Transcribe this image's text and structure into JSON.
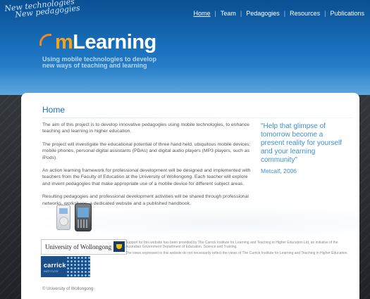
{
  "header": {
    "tagline": [
      "New technologies",
      "New pedagogies"
    ],
    "logo": {
      "prefix": "m",
      "text": "Learning"
    },
    "logo_subtitle": [
      "Using mobile technologies to develop",
      "new ways of teaching and learning"
    ],
    "nav": [
      {
        "label": "Home",
        "active": true
      },
      {
        "label": "Team",
        "active": false
      },
      {
        "label": "Pedagogies",
        "active": false
      },
      {
        "label": "Resources",
        "active": false
      },
      {
        "label": "Publications",
        "active": false
      }
    ]
  },
  "main": {
    "title": "Home",
    "paragraphs": [
      "The aim of this project is to develop innovative pedagogies using mobile technologies, to enhance teaching and learning in higher education.",
      "The project will investigate the educational potential of three hand held, ubiquitous mobile devices: mobile phones, personal digital assistants (PDAs) and digital audio players (MP3 players, such as iPods).",
      "An action learning framework for professional development will be designed and implemented with teachers from the Faculty of Education at the University of Wollongong. Each teacher will explore and invent pedagogies that make appropriate use of a mobile device for different subject areas.",
      "Resulting pedagogies and professional development activities will be shared through professional networks, workshops, a dedicated website and a published handbook."
    ],
    "quote": "\"Help that glimpse of tomorrow become a present reality for yourself and your learning community\"",
    "quote_author": "Metcalf, 2006"
  },
  "footer": {
    "uow_label": "University of Wollongong",
    "carrick_label": "carrick",
    "carrick_sub": "INSTITUTE",
    "support_text": "Support for this website has been provided by The Carrick Institute for Learning and Teaching in Higher Education Ltd, an initiative of the Australian Government Department of Education, Science and Training.",
    "disclaimer": "The views expressed in this website do not necessarily reflect the views of The Carrick Institute for Learning and Teaching in Higher Education.",
    "copyright": "© University of Wollongong"
  },
  "colors": {
    "header_blue": "#1b73bf",
    "accent_orange": "#f5a21c",
    "quote_blue": "#3f8fd4"
  },
  "icons": [
    "ipod-image",
    "pda-image",
    "uow-crest-icon",
    "carrick-logo"
  ]
}
